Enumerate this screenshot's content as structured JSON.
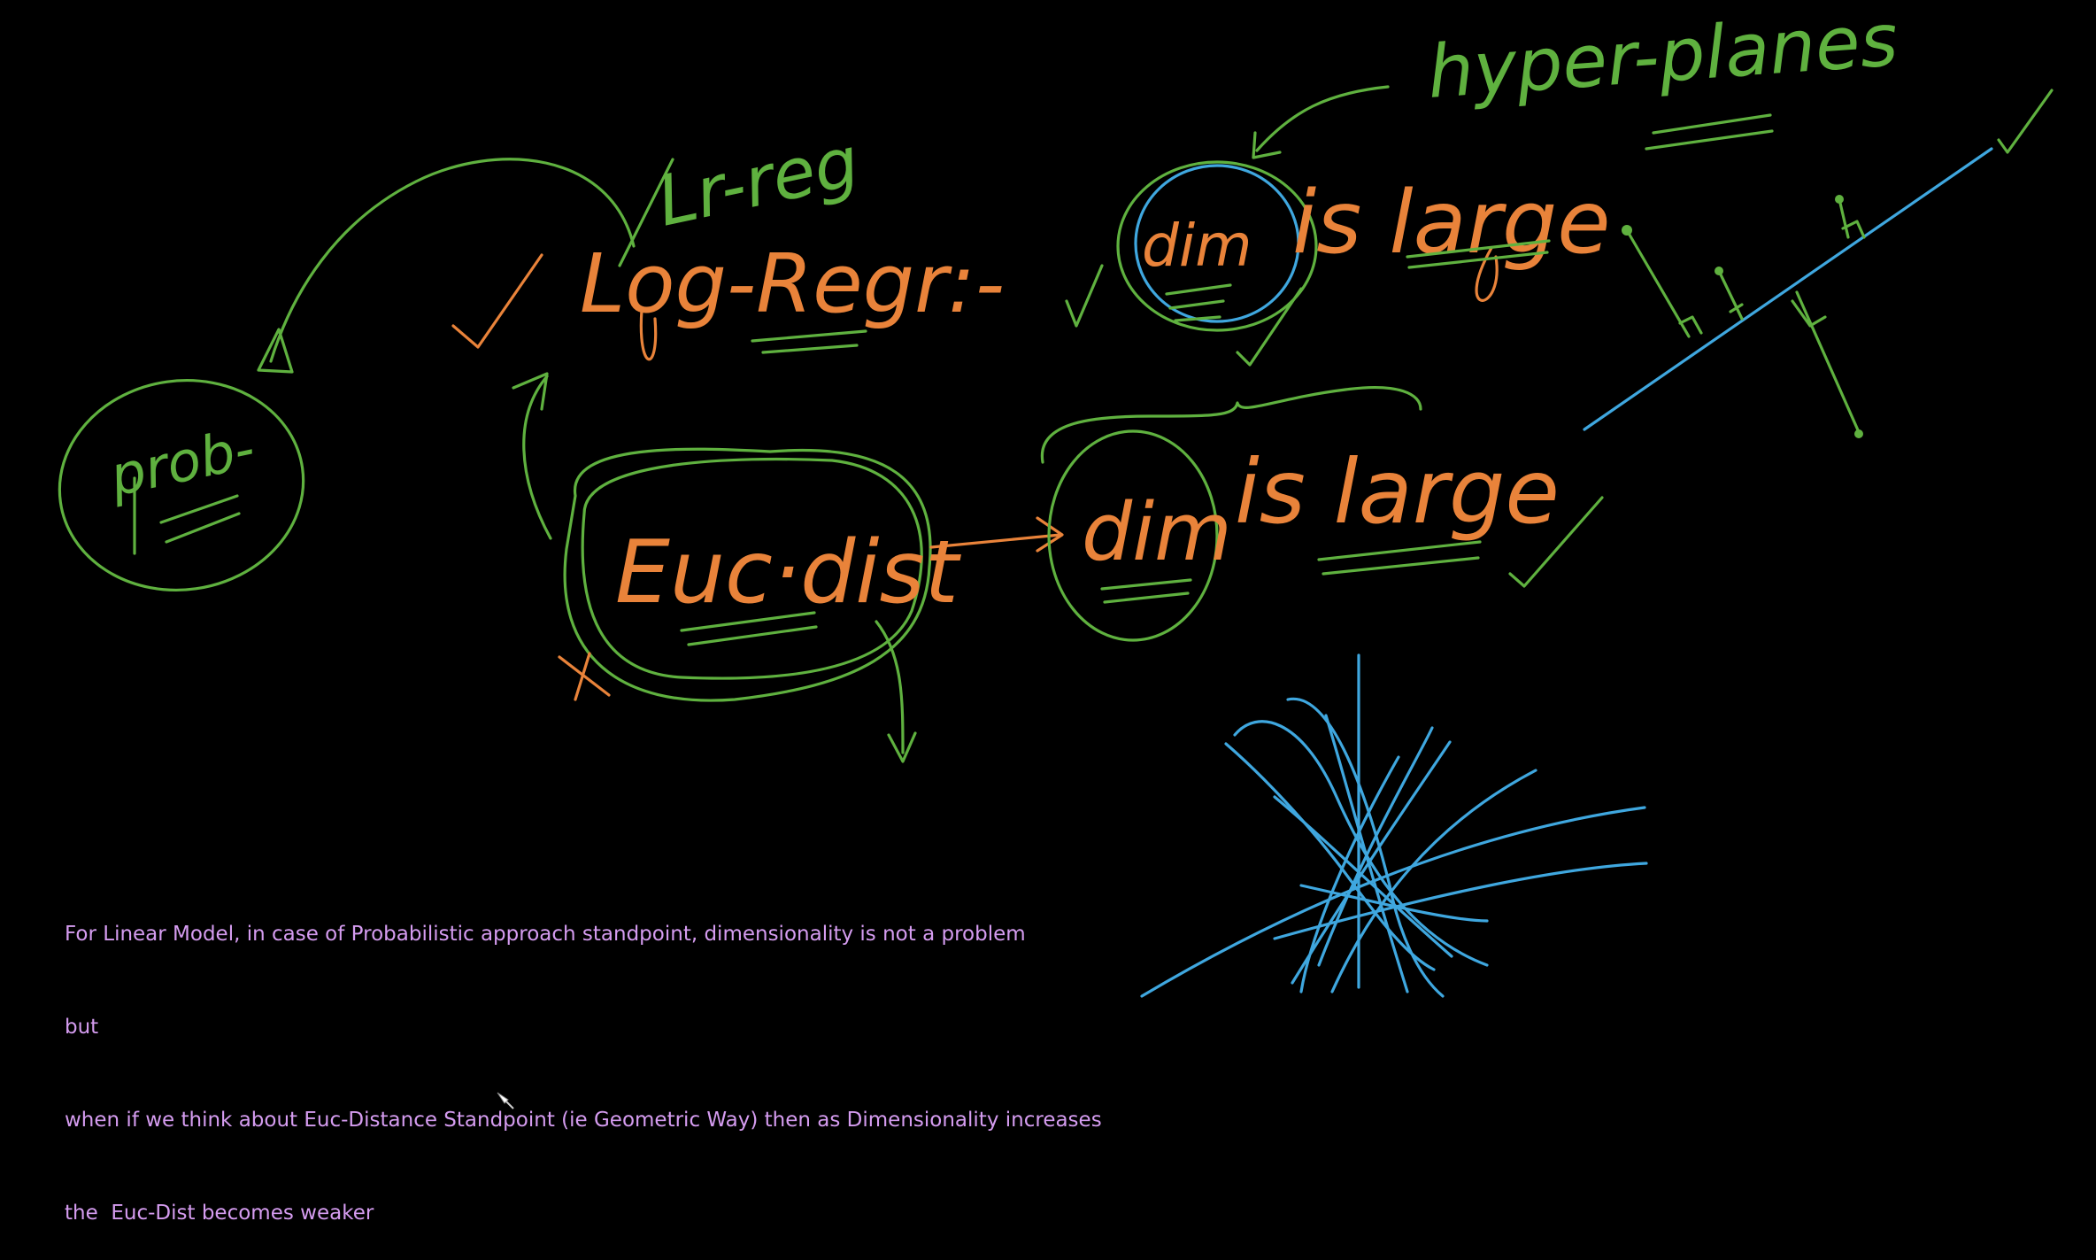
{
  "board": {
    "background": "#000000",
    "ink_colors": {
      "green": "#5fb13f",
      "orange": "#e9833a",
      "blue": "#3fa7df",
      "note": "#d59cf0"
    },
    "handwritten": {
      "prob": "prob-",
      "lr_reg": "Lr-reg",
      "log_regr": "Log-Regr:-",
      "euc_dist": "Euc·dist",
      "dim_top": "dim",
      "is_large_top": "is large",
      "dim_mid": "dim",
      "is_large_mid": "is large",
      "hyper_planes": "hyper-planes"
    },
    "note_lines": [
      "For Linear Model, in case of Probabilistic approach standpoint, dimensionality is not a problem",
      "but",
      "when if we think about Euc-Distance Standpoint (ie Geometric Way) then as Dimensionality increases",
      "the  Euc-Dist becomes weaker"
    ]
  }
}
